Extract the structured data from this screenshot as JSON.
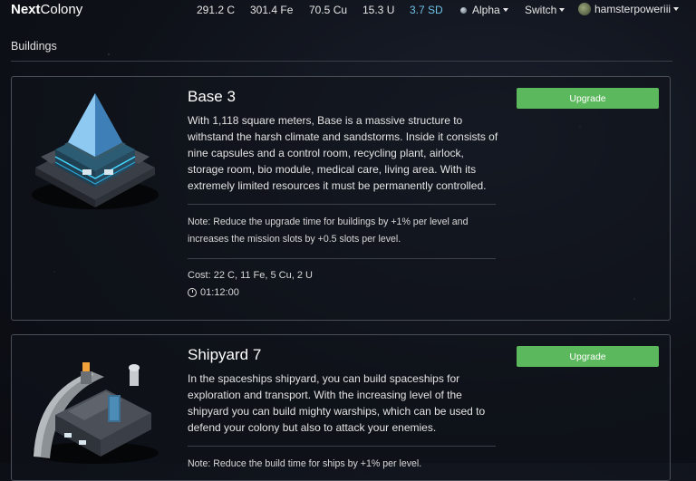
{
  "nav": {
    "brand_bold": "Next",
    "brand_rest": "Colony",
    "resources": [
      {
        "label": "291.2 C"
      },
      {
        "label": "301.4 Fe"
      },
      {
        "label": "70.5 Cu"
      },
      {
        "label": "15.3 U"
      },
      {
        "label": "3.7 SD"
      }
    ],
    "planet_menu": "Alpha",
    "switch_menu": "Switch",
    "user_menu": "hamsterpoweriii"
  },
  "page": {
    "section_title": "Buildings"
  },
  "buildings": [
    {
      "title": "Base 3",
      "description": "With 1,118 square meters, Base is a massive structure to withstand the harsh climate and sandstorms. Inside it consists of nine capsules and a control room, recycling plant, airlock, storage room, bio module, medical care, living area. With its extremely limited resources it must be permanently controlled.",
      "note": "Note: Reduce the upgrade time for buildings by +1% per level and increases the mission slots by +0.5 slots per level.",
      "cost": "Cost: 22 C, 11 Fe, 5 Cu, 2 U",
      "time": "01:12:00",
      "button": "Upgrade"
    },
    {
      "title": "Shipyard 7",
      "description": "In the spaceships shipyard, you can build spaceships for exploration and transport. With the increasing level of the shipyard you can build mighty warships, which can be used to defend your colony but also to attack your enemies.",
      "note": "Note: Reduce the build time for ships by +1% per level.",
      "button": "Upgrade"
    }
  ],
  "colors": {
    "upgrade_button": "#5cb85c",
    "sd_resource": "#6fc2e8",
    "background": "#0e1118"
  }
}
